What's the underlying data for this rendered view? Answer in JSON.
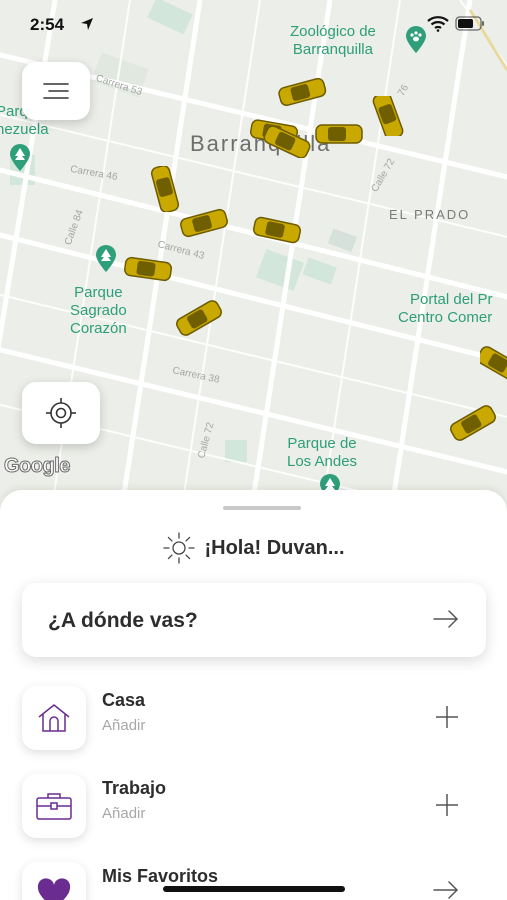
{
  "status_bar": {
    "time": "2:54"
  },
  "map": {
    "city": "Barranquilla",
    "district": "EL PRADO",
    "pois": {
      "zoo": [
        "Zoológico de",
        "Barranquilla"
      ],
      "parque_venezuela": [
        "Parque",
        "nezuela"
      ],
      "parque_sagrado": [
        "Parque",
        "Sagrado",
        "Corazón"
      ],
      "portal": [
        "Portal del Pr",
        "Centro Comer"
      ],
      "parque_andes": [
        "Parque de",
        "Los Andes"
      ]
    },
    "streets": {
      "carrera53": "Carrera 53",
      "carrera46": "Carrera 46",
      "carrera43": "Carrera 43",
      "carrera38": "Carrera 38",
      "calle84": "Calle 84",
      "calle72": "Calle 72",
      "calle72b": "Calle 72",
      "calle76": "76"
    },
    "attribution": "Google"
  },
  "sheet": {
    "greeting": "¡Hola! Duvan...",
    "destination_prompt": "¿A dónde vas?",
    "places": [
      {
        "title": "Casa",
        "subtitle": "Añadir",
        "icon": "house-icon"
      },
      {
        "title": "Trabajo",
        "subtitle": "Añadir",
        "icon": "briefcase-icon"
      },
      {
        "title": "Mis Favoritos",
        "subtitle": "",
        "icon": "heart-icon"
      }
    ]
  },
  "colors": {
    "accent": "#6a2c91",
    "poi": "#2e9e7b",
    "taxi": "#c9a800"
  }
}
